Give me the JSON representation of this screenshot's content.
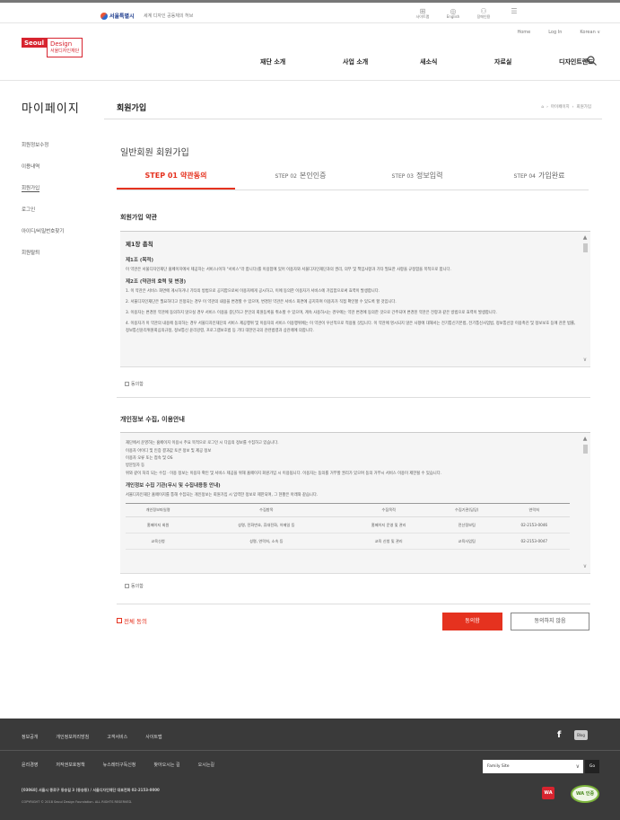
{
  "topbar": {
    "gov_logo": "서울특별시",
    "gov_text": "세계 디자인 공동체의 허브",
    "icons": [
      {
        "name": "sitemap-icon",
        "label": "사이트맵"
      },
      {
        "name": "globe-icon",
        "label": "English"
      },
      {
        "name": "people-icon",
        "label": "장애인용"
      },
      {
        "name": "menu-icon",
        "label": ""
      }
    ]
  },
  "header": {
    "logo_main": "Seoul",
    "logo_box": "Design",
    "logo_sub": "서울디자인재단",
    "util": [
      "Home",
      "Log In",
      "Korean"
    ],
    "gnb": [
      "재단 소개",
      "사업 소개",
      "새소식",
      "자료실",
      "디자인트렌드"
    ]
  },
  "lnb": {
    "title": "마이페이지",
    "items": [
      "회원정보수정",
      "이용내역",
      "회원가입",
      "로그인",
      "아이디/비밀번호찾기",
      "회원탈퇴"
    ]
  },
  "page": {
    "title": "회원가입",
    "breadcrumb": [
      "마이페이지",
      "회원가입"
    ],
    "form_title": "일반회원 회원가입"
  },
  "steps": [
    {
      "num": "STEP 01",
      "label": "약관동의"
    },
    {
      "num": "STEP 02",
      "label": "본인인증"
    },
    {
      "num": "STEP 03",
      "label": "정보입력"
    },
    {
      "num": "STEP 04",
      "label": "가입완료"
    }
  ],
  "terms": {
    "heading": "회원가입 약관",
    "chapter": "제1장 총칙",
    "art1_title": "제1조 (목적)",
    "art1_text": "이 약관은 서울디자인재단 홈페이지에서 제공하는 서비스(이하 \"서비스\"라 합니다)를 이용함에 있어 이용자와 서울디자인재단과의 권리, 의무 및 책임사항과 기타 필요한 사항을 규정함을 목적으로 합니다.",
    "art2_title": "제2조 (약관의 효력 및 변경)",
    "art2_p1": "1. 이 약관은 서비스 화면에 게시하거나 기타의 방법으로 공지함으로써 이용자에게 공시하고, 이에 동의한 이용자가 서비스에 가입함으로써 효력이 발생합니다.",
    "art2_p2": "2. 서울디자인재단은 필요하다고 인정되는 경우 이 약관의 내용을 변경할 수 있으며, 변경된 약관은 서비스 화면에 공지하며 이용자가 직접 확인할 수 있도록 할 것입니다.",
    "art2_p3": "3. 이용자는 변경된 약관에 동의하지 않으실 경우 서비스 이용을 중단하고 본인의 회원등록을 취소할 수 있으며, 계속 사용하시는 경우에는 약관 변경에 동의한 것으로 간주되며 변경된 약관은 전항과 같은 방법으로 효력이 발생합니다.",
    "art2_p4": "4. 이용자가 이 약관의 내용에 동의하는 경우 서울디자인재단의 서비스 제공행위 및 이용자의 서비스 이용행위에는 이 약관이 우선적으로 적용될 것입니다. 이 약관에 명시되지 않은 사항에 대해서는 전기통신기본법, 전기통신사업법, 정보통신망 이용촉진 및 정보보호 등에 관한 법률, 정보통신윤리위원회심의규정, 정보통신 윤리강령, 프로그램보호법 등 기타 대한민국의 관련법령과 상관례에 의합니다.",
    "agree_label": "동의함"
  },
  "privacy": {
    "heading": "개인정보 수집, 이용안내",
    "p1": "재단에서 운영하는 홈페이지 이용시 주요 목적으로 로그인 시 다음의 정보를 수집하고 있습니다.",
    "p2": "이용자 아이디 및 인증 결과값 토큰 정보 및 제공 정보",
    "p3": "이용자 오류 또는 접속 및 OS",
    "p4": "방문일자 등",
    "p5": "위와 같이 처리 되는 수집 · 이용 정보는 이용자 확인 및 서비스 제공을 위해 홈페이지 회원가입 시 이용됩니다. 이용자는 동의를 거부할 권리가 있으며 동의 거부시 서비스 이용이 제한될 수 있습니다.",
    "sub_title": "개인정보 수집 기관(무시 및 수집내용등 안내)",
    "sub_text": "서울디자인재단 홈페이지를 통해 수집되는 개인정보는 회원가입 시 입력한 정보로 제한되며, 그 현황은 아래와 같습니다.",
    "table": {
      "headers": [
        "개인정보파일명",
        "수집항목",
        "수집목적",
        "수집기관(담당)",
        "연락처"
      ],
      "rows": [
        [
          "홈페이지 회원",
          "성명, 전화번호, 휴대전화, 이메일 등",
          "홈페이지 운영 및 관리",
          "전산정보팀",
          "02-2153-0046"
        ],
        [
          "교육신청",
          "성명, 연락처, 소속 등",
          "교육 신청 및 관리",
          "교육사업팀",
          "02-2153-0047"
        ]
      ]
    },
    "agree_label": "동의함"
  },
  "actions": {
    "all_agree": "전체 동의",
    "agree": "동의함",
    "disagree": "동의하지 않음"
  },
  "footer": {
    "links1": [
      "정보공개",
      "개인정보처리방침",
      "고객서비스",
      "사이트맵"
    ],
    "links2": [
      "윤리경영",
      "저작권보호정책",
      "뉴스레터구독신청",
      "찾아오시는 길",
      "오시는길"
    ],
    "family_site": "Family Site",
    "go": "Go",
    "address": "[03068] 서울시 종로구 동숭길 3 (동숭동) / 서울디자인재단 대표전화 02-2153-0000",
    "copyright": "COPYRIGHT © 2018 Seoul Design Foundation. ALL RIGHTS RESERVED.",
    "blog": "Blog",
    "badge1": "WA",
    "badge2": "WA 인증"
  },
  "colors": {
    "accent": "#e5321f",
    "brand": "#d7242f",
    "footer_bg": "#3a3a3a"
  }
}
